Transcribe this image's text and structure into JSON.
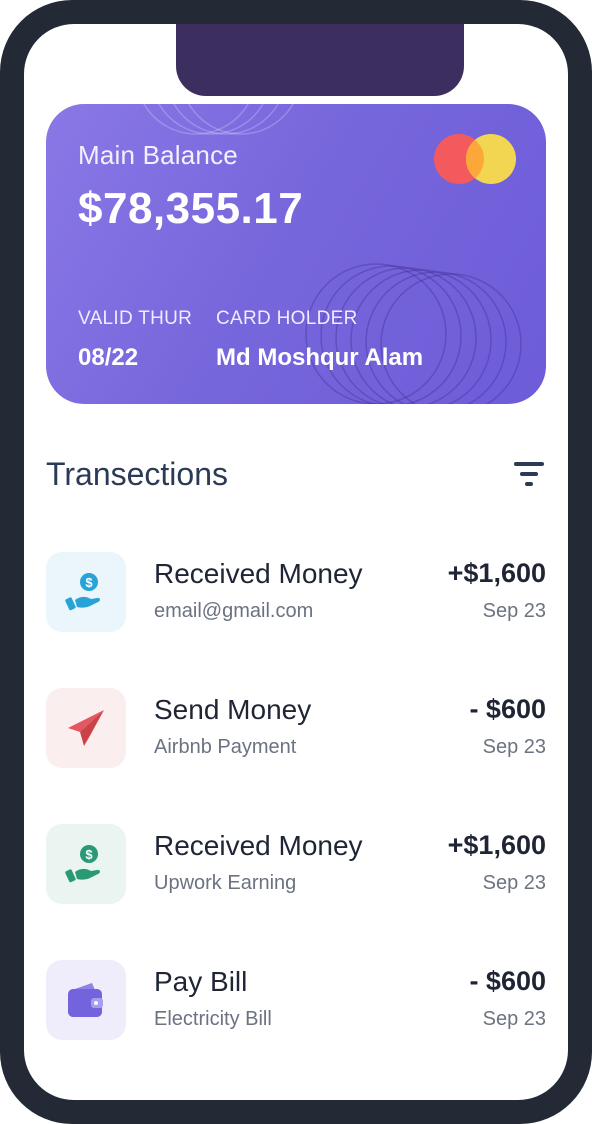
{
  "card": {
    "label": "Main Balance",
    "balance": "$78,355.17",
    "valid_label": "VALID THUR",
    "valid_value": "08/22",
    "holder_label": "CARD HOLDER",
    "holder_value": "Md Moshqur Alam",
    "brand_icon": "mastercard-icon",
    "gradient_colors": [
      "#8a78e6",
      "#6d5cd8"
    ]
  },
  "transactions": {
    "title": "Transections",
    "filter_icon": "filter-icon",
    "items": [
      {
        "icon": "receive-money-icon",
        "title": "Received Money",
        "subtitle": "email@gmail.com",
        "amount": "+$1,600",
        "date": "Sep 23",
        "icon_bg": "#eaf6fb",
        "icon_color": "#27a3d6"
      },
      {
        "icon": "paper-plane-icon",
        "title": "Send Money",
        "subtitle": "Airbnb Payment",
        "amount": "- $600",
        "date": "Sep 23",
        "icon_bg": "#fbeeee",
        "icon_color": "#e5575e"
      },
      {
        "icon": "receive-money-icon",
        "title": "Received Money",
        "subtitle": "Upwork Earning",
        "amount": "+$1,600",
        "date": "Sep 23",
        "icon_bg": "#eaf5f1",
        "icon_color": "#2a9a76"
      },
      {
        "icon": "wallet-icon",
        "title": "Pay Bill",
        "subtitle": "Electricity Bill",
        "amount": "- $600",
        "date": "Sep 23",
        "icon_bg": "#efedfc",
        "icon_color": "#7363dc"
      }
    ]
  }
}
